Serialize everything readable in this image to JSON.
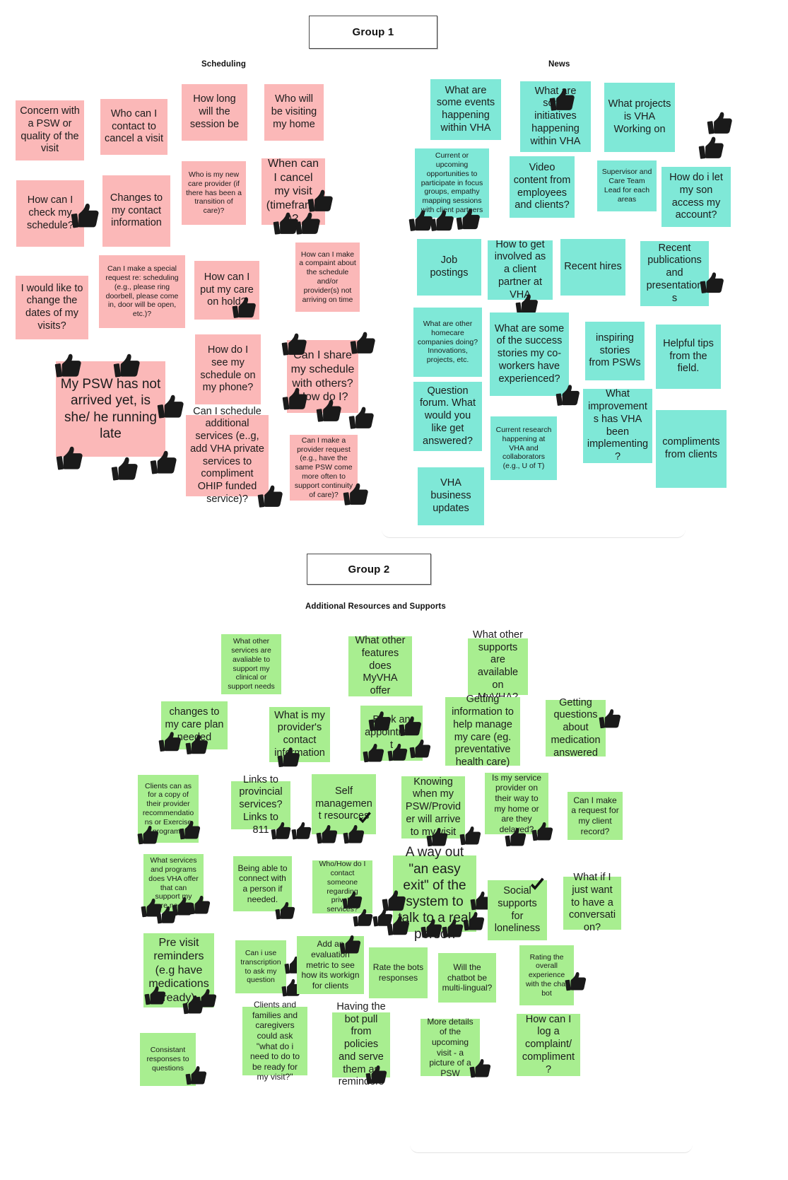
{
  "groups": [
    {
      "title": "Group 1",
      "sections": [
        {
          "heading": "Scheduling"
        },
        {
          "heading": "News"
        }
      ]
    },
    {
      "title": "Group 2",
      "sections": [
        {
          "heading": "Additional Resources and Supports"
        }
      ]
    }
  ],
  "colors": {
    "pink": "#fbb8b8",
    "teal": "#7fe8d7",
    "green": "#a8ee90",
    "text": "#1c1c1c",
    "box_border": "#4a4a4a"
  },
  "scheduling_notes": [
    {
      "text": "Concern with a PSW or quality of the visit"
    },
    {
      "text": "Who can I contact to cancel a visit"
    },
    {
      "text": "How long will the session be"
    },
    {
      "text": "Who will be visiting my home"
    },
    {
      "text": "How can I check my schedule?"
    },
    {
      "text": "Changes to my contact information"
    },
    {
      "text": "Who is my new care provider (if there has been a transition of care)?"
    },
    {
      "text": "When can I cancel my visit (timeframe)?"
    },
    {
      "text": "I would like to change the dates of my visits?"
    },
    {
      "text": "Can I make a special request re: scheduling (e.g., please ring doorbell, please come in, door will be open, etc.)?"
    },
    {
      "text": "How can I put my care on hold?"
    },
    {
      "text": "How can I make a compaint about the schedule and/or provider(s) not arriving on time"
    },
    {
      "text": "My PSW has not arrived yet, is she/ he running late"
    },
    {
      "text": "How do I see my schedule on my phone?"
    },
    {
      "text": "Can I share my schedule with others? How do I?"
    },
    {
      "text": "Can I schedule additional services (e..g, add VHA private services to compliment OHIP funded service)?"
    },
    {
      "text": "Can I make a provider request (e.g., have the same PSW come more often to support continuity of care)?"
    }
  ],
  "news_notes": [
    {
      "text": "What are some events happening within VHA"
    },
    {
      "text": "What are some initiatives happening within VHA"
    },
    {
      "text": "What projects is VHA Working on"
    },
    {
      "text": "Current or upcoming opportunities to participate in focus groups, empathy mapping sessions with client partners"
    },
    {
      "text": "Video content from employees and clients?"
    },
    {
      "text": "Supervisor and Care Team Lead for each areas"
    },
    {
      "text": "How do i let my son access my account?"
    },
    {
      "text": "Job postings"
    },
    {
      "text": "How to get involved as a client partner at VHA"
    },
    {
      "text": "Recent hires"
    },
    {
      "text": "Recent publications and presentations"
    },
    {
      "text": "What are other homecare companies doing? Innovations, projects, etc."
    },
    {
      "text": "What are some of the success stories my co-workers have experienced?"
    },
    {
      "text": "inspiring stories from PSWs"
    },
    {
      "text": "Helpful tips from the field."
    },
    {
      "text": "Question forum.  What would you like get answered?"
    },
    {
      "text": "Current research happening at VHA and collaborators (e.g., U of T)"
    },
    {
      "text": "What improvements has VHA been implementing?"
    },
    {
      "text": "compliments from clients"
    },
    {
      "text": "VHA business updates"
    }
  ],
  "resources_notes": [
    {
      "text": "What other services are avaliable to support my clinical or support needs"
    },
    {
      "text": "What other features does MyVHA offer"
    },
    {
      "text": "What other supports are available on MyVHA?"
    },
    {
      "text": "changes to my care plan needed"
    },
    {
      "text": "What is my provider's contact information"
    },
    {
      "text": "Book an appointment"
    },
    {
      "text": "Getting information to help manage my care (eg. preventative health care)"
    },
    {
      "text": "Getting questions about medication answered"
    },
    {
      "text": "Clients can as for a copy of their provider recommendations or Exercise programs"
    },
    {
      "text": "Links to provincial services? Links to 811"
    },
    {
      "text": "Self management resources"
    },
    {
      "text": "Knowing when my PSW/Provider will arrive to my visit"
    },
    {
      "text": "Is my service provider on their way to my home or are they delayed?"
    },
    {
      "text": "Can I make a request for my client record?"
    },
    {
      "text": "What services and programs does VHA offer that can support my care needs?"
    },
    {
      "text": "Being able to connect with a person if needed."
    },
    {
      "text": "Who/How do I contact someone regarding private services?"
    },
    {
      "text": "A way out \"an easy exit\" of the system to talk to a real person"
    },
    {
      "text": "Social supports for loneliness"
    },
    {
      "text": "What if I just want to have a conversation?"
    },
    {
      "text": "Pre visit reminders (e.g have medications ready)"
    },
    {
      "text": "Can i use transcription to ask my question"
    },
    {
      "text": "Add an evaluation metric to see how its workign for clients"
    },
    {
      "text": "Rate the bots responses"
    },
    {
      "text": "Will the chatbot be multi-lingual?"
    },
    {
      "text": "Rating the overall experience with the chat bot"
    },
    {
      "text": "Consistant responses to questions"
    },
    {
      "text": "Clients and families and caregivers could ask \"what do i need to do to be ready for my visit?\""
    },
    {
      "text": "Having the bot pull from policies and serve them as reminders"
    },
    {
      "text": "More details of the upcoming visit - a picture of a PSW"
    },
    {
      "text": "How can I log a complaint/ compliment?"
    }
  ],
  "stickers": {
    "thumbs_up": "thumbs-up-sticker",
    "check": "check-mark-sticker"
  }
}
